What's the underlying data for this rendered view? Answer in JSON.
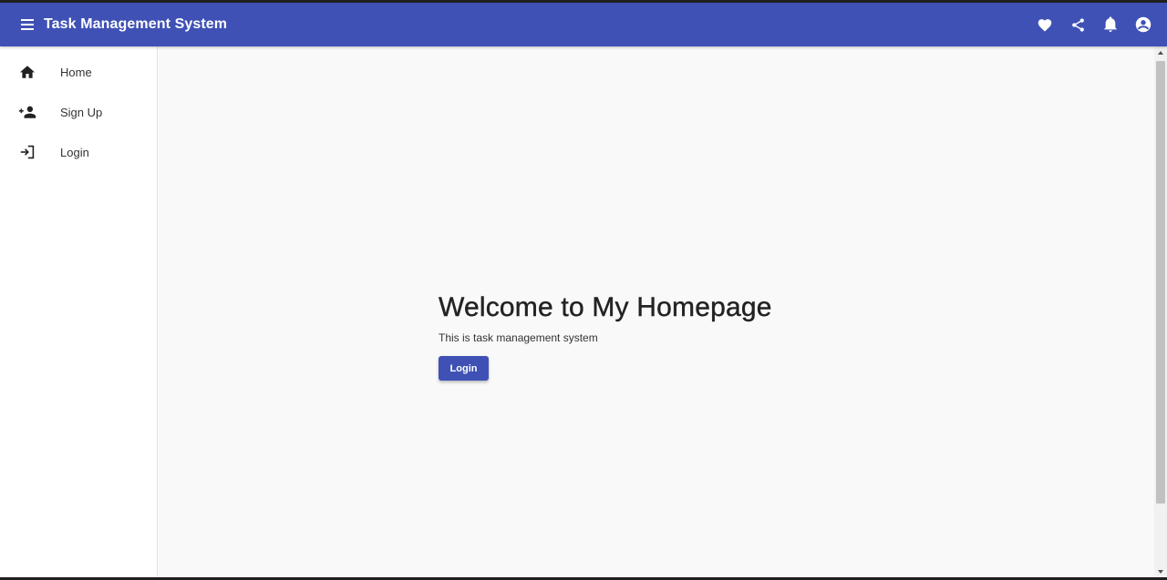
{
  "toolbar": {
    "title": "Task Management System",
    "menu_icon": "menu-icon",
    "actions": [
      "heart-icon",
      "share-icon",
      "bell-icon",
      "account-circle-icon"
    ],
    "color": "#3f51b5"
  },
  "sidebar": {
    "items": [
      {
        "label": "Home",
        "icon": "home-icon"
      },
      {
        "label": "Sign Up",
        "icon": "person-add-icon"
      },
      {
        "label": "Login",
        "icon": "login-icon"
      }
    ]
  },
  "main": {
    "heading": "Welcome to My Homepage",
    "subtitle": "This is task management system",
    "login_button": "Login"
  }
}
